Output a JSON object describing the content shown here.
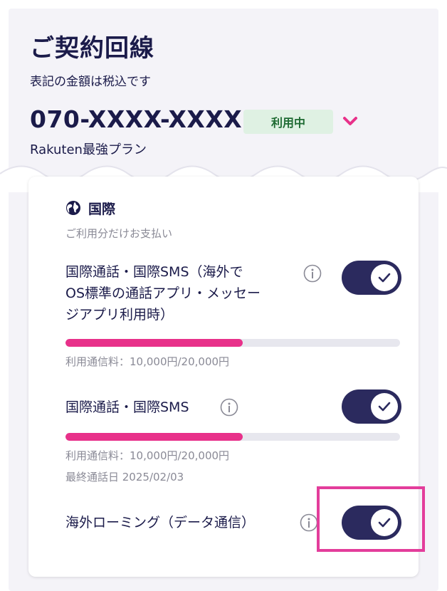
{
  "header": {
    "title": "ご契約回線",
    "subtitle": "表記の金額は税込です",
    "phone_number": "070-XXXX-XXXX",
    "status_badge": "利用中",
    "plan_name": "Rakuten最強プラン"
  },
  "section": {
    "icon": "globe-icon",
    "title": "国際",
    "description": "ご利用分だけお支払い"
  },
  "items": [
    {
      "label_lines": [
        "国際通話・国際SMS（海外で",
        "OS標準の通話アプリ・メッセー",
        "ジアプリ利用時）"
      ],
      "toggle_on": true,
      "usage_fraction": 0.53,
      "usage_text": "利用通信料：10,000円/20,000円"
    },
    {
      "label": "国際通話・国際SMS",
      "toggle_on": true,
      "usage_fraction": 0.53,
      "usage_text": "利用通信料：10,000円/20,000円",
      "last_call_text": "最終通話日 2025/02/03"
    },
    {
      "label": "海外ローミング（データ通信）",
      "toggle_on": true
    }
  ],
  "colors": {
    "navy": "#2b2a5e",
    "accent_pink": "#e8318a",
    "badge_bg": "#dff1e3",
    "badge_text": "#1f6b33",
    "highlight_border": "#e33d9b"
  }
}
